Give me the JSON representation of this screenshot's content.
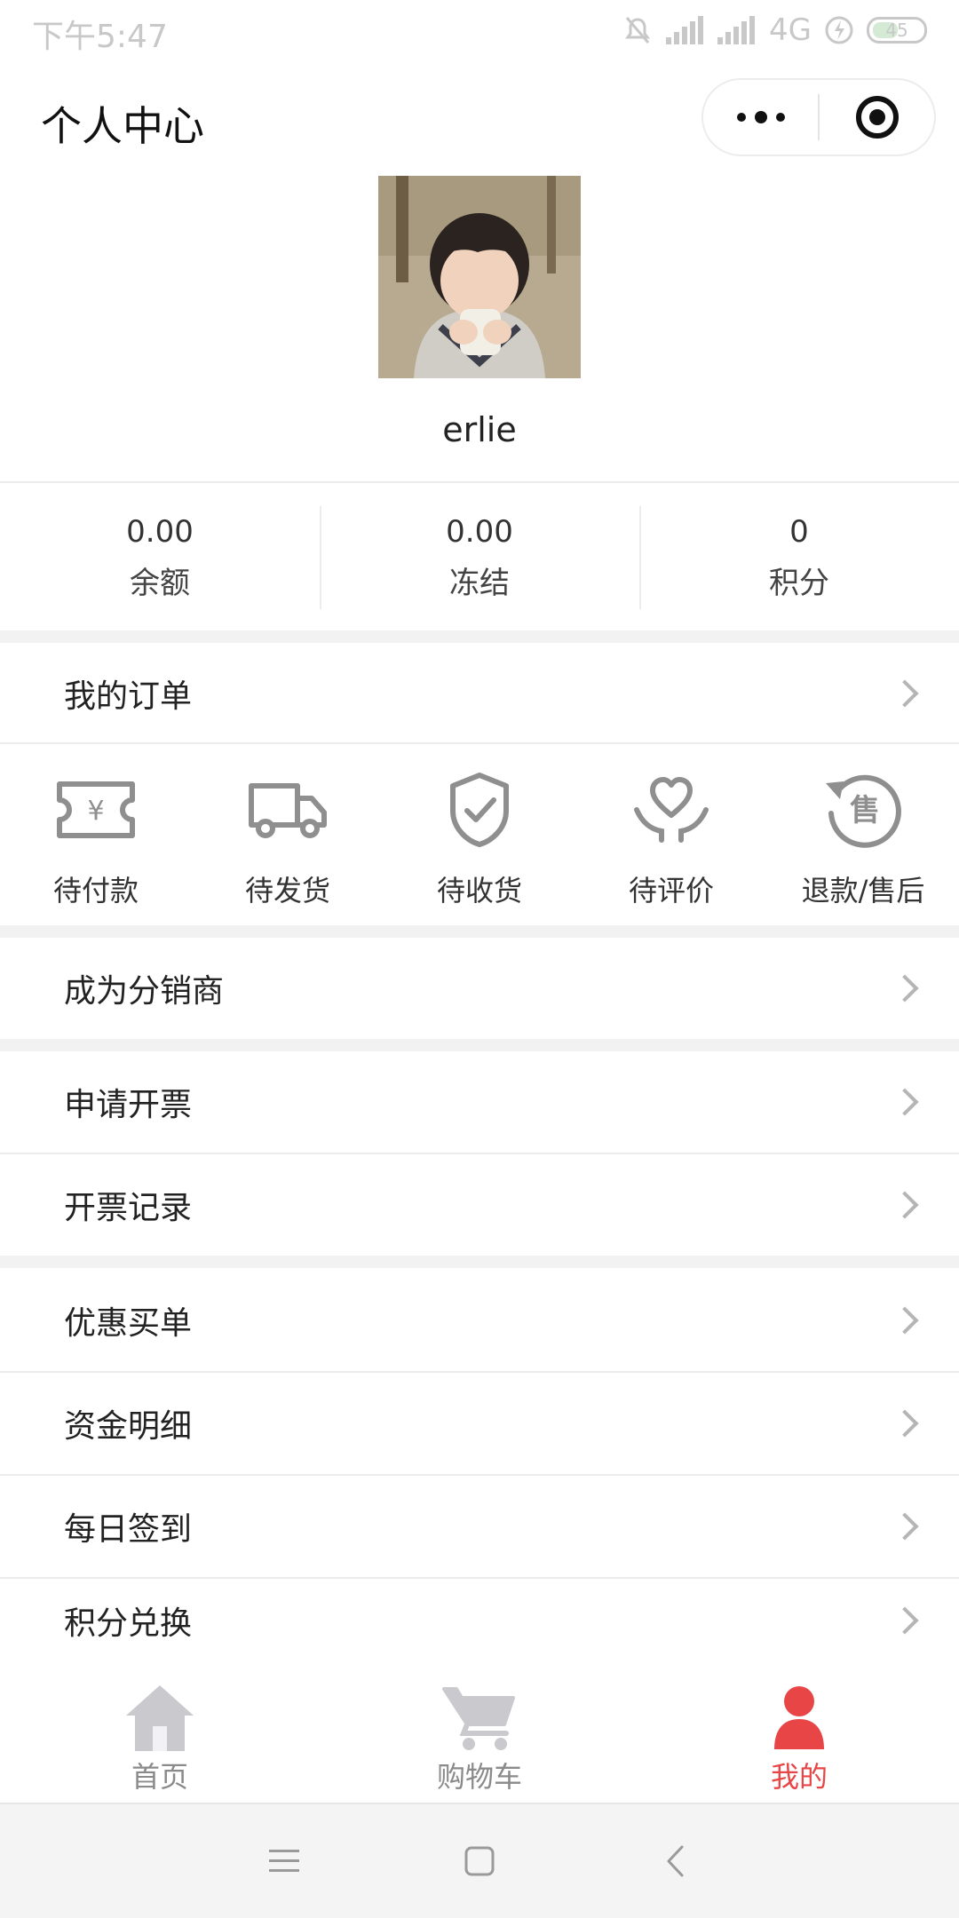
{
  "status_bar": {
    "time": "下午5:47",
    "network": "4G",
    "battery": "45"
  },
  "header": {
    "title": "个人中心"
  },
  "profile": {
    "username": "erlie"
  },
  "stats": [
    {
      "value": "0.00",
      "label": "余额"
    },
    {
      "value": "0.00",
      "label": "冻结"
    },
    {
      "value": "0",
      "label": "积分"
    }
  ],
  "orders": {
    "title": "我的订单",
    "items": [
      {
        "label": "待付款",
        "icon": "payment-ticket-icon",
        "glyph": "¥"
      },
      {
        "label": "待发货",
        "icon": "truck-icon"
      },
      {
        "label": "待收货",
        "icon": "shield-check-icon"
      },
      {
        "label": "待评价",
        "icon": "heart-hands-icon"
      },
      {
        "label": "退款/售后",
        "icon": "refund-aftersale-icon",
        "glyph": "售"
      }
    ]
  },
  "menu": {
    "distributor": "成为分销商",
    "apply_invoice": "申请开票",
    "invoice_records": "开票记录",
    "discount_bill": "优惠买单",
    "fund_details": "资金明细",
    "daily_checkin": "每日签到",
    "points_exchange": "积分兑换"
  },
  "tabbar": [
    {
      "label": "首页",
      "icon": "home-icon"
    },
    {
      "label": "购物车",
      "icon": "cart-icon"
    },
    {
      "label": "我的",
      "icon": "user-icon",
      "active": true
    }
  ],
  "colors": {
    "accent": "#e84646",
    "icon_gray": "#8f8f8f",
    "divider": "#ececec",
    "section_bg": "#f2f2f2"
  }
}
